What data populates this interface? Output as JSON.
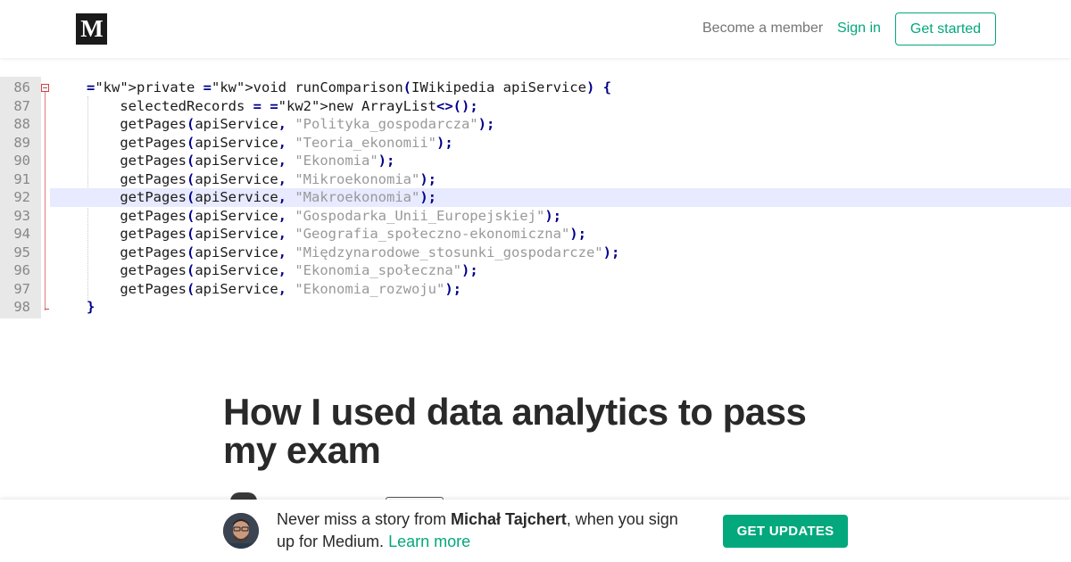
{
  "header": {
    "logo": "M",
    "become_member": "Become a member",
    "sign_in": "Sign in",
    "get_started": "Get started"
  },
  "code": {
    "lines": [
      {
        "num": "86",
        "text": "private void runComparison(IWikipedia apiService) {"
      },
      {
        "num": "87",
        "text": "    selectedRecords = new ArrayList<>();"
      },
      {
        "num": "88",
        "text": "    getPages(apiService, \"Polityka_gospodarcza\");"
      },
      {
        "num": "89",
        "text": "    getPages(apiService, \"Teoria_ekonomii\");"
      },
      {
        "num": "90",
        "text": "    getPages(apiService, \"Ekonomia\");"
      },
      {
        "num": "91",
        "text": "    getPages(apiService, \"Mikroekonomia\");"
      },
      {
        "num": "92",
        "text": "    getPages(apiService, \"Makroekonomia\");"
      },
      {
        "num": "93",
        "text": "    getPages(apiService, \"Gospodarka_Unii_Europejskiej\");"
      },
      {
        "num": "94",
        "text": "    getPages(apiService, \"Geografia_społeczno-ekonomiczna\");"
      },
      {
        "num": "95",
        "text": "    getPages(apiService, \"Międzynarodowe_stosunki_gospodarcze\");"
      },
      {
        "num": "96",
        "text": "    getPages(apiService, \"Ekonomia_społeczna\");"
      },
      {
        "num": "97",
        "text": "    getPages(apiService, \"Ekonomia_rozwoju\");"
      },
      {
        "num": "98",
        "text": "}"
      }
    ],
    "highlighted_line": "92"
  },
  "article": {
    "title": "How I used data analytics to pass my exam"
  },
  "banner": {
    "text_before": "Never miss a story from ",
    "author": "Michał Tajchert",
    "text_after": ", when you sign up for Medium. ",
    "learn_more": "Learn more",
    "button": "GET UPDATES"
  },
  "colors": {
    "accent": "#03a87c",
    "highlight_line": "#e8eaff",
    "gutter": "#e8e8e8"
  }
}
